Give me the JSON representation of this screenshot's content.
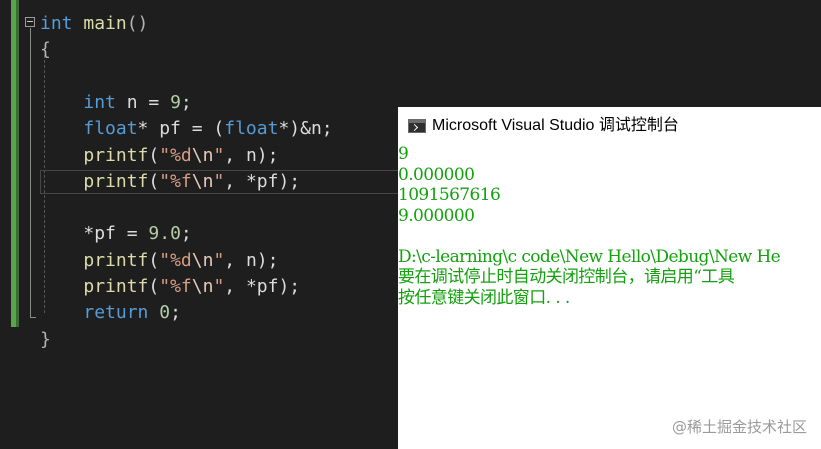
{
  "editor": {
    "lines": [
      {
        "tokens": [
          {
            "t": "int",
            "c": "kw"
          },
          {
            "t": " ",
            "c": "id"
          },
          {
            "t": "main",
            "c": "fn"
          },
          {
            "t": "()",
            "c": "punc"
          }
        ]
      },
      {
        "tokens": [
          {
            "t": "{",
            "c": "punc"
          }
        ]
      },
      {
        "tokens": []
      },
      {
        "tokens": [
          {
            "t": "    ",
            "c": "id"
          },
          {
            "t": "int",
            "c": "kw"
          },
          {
            "t": " n = ",
            "c": "id"
          },
          {
            "t": "9",
            "c": "num"
          },
          {
            "t": ";",
            "c": "id"
          }
        ]
      },
      {
        "tokens": [
          {
            "t": "    ",
            "c": "id"
          },
          {
            "t": "float",
            "c": "kw"
          },
          {
            "t": "* pf = (",
            "c": "id"
          },
          {
            "t": "float",
            "c": "kw"
          },
          {
            "t": "*)&n;",
            "c": "id"
          }
        ]
      },
      {
        "tokens": [
          {
            "t": "    ",
            "c": "id"
          },
          {
            "t": "printf",
            "c": "fn"
          },
          {
            "t": "(",
            "c": "id"
          },
          {
            "t": "\"%d",
            "c": "str"
          },
          {
            "t": "\\n",
            "c": "esc"
          },
          {
            "t": "\"",
            "c": "str"
          },
          {
            "t": ", n);",
            "c": "id"
          }
        ]
      },
      {
        "tokens": [
          {
            "t": "    ",
            "c": "id"
          },
          {
            "t": "printf",
            "c": "fn"
          },
          {
            "t": "(",
            "c": "id"
          },
          {
            "t": "\"%f",
            "c": "str"
          },
          {
            "t": "\\n",
            "c": "esc"
          },
          {
            "t": "\"",
            "c": "str"
          },
          {
            "t": ", *pf);",
            "c": "id"
          }
        ]
      },
      {
        "tokens": []
      },
      {
        "tokens": [
          {
            "t": "    ",
            "c": "id"
          },
          {
            "t": "*pf = ",
            "c": "id"
          },
          {
            "t": "9.0",
            "c": "num"
          },
          {
            "t": ";",
            "c": "id"
          }
        ]
      },
      {
        "tokens": [
          {
            "t": "    ",
            "c": "id"
          },
          {
            "t": "printf",
            "c": "fn"
          },
          {
            "t": "(",
            "c": "id"
          },
          {
            "t": "\"%d",
            "c": "str"
          },
          {
            "t": "\\n",
            "c": "esc"
          },
          {
            "t": "\"",
            "c": "str"
          },
          {
            "t": ", n);",
            "c": "id"
          }
        ]
      },
      {
        "tokens": [
          {
            "t": "    ",
            "c": "id"
          },
          {
            "t": "printf",
            "c": "fn"
          },
          {
            "t": "(",
            "c": "id"
          },
          {
            "t": "\"%f",
            "c": "str"
          },
          {
            "t": "\\n",
            "c": "esc"
          },
          {
            "t": "\"",
            "c": "str"
          },
          {
            "t": ", *pf);",
            "c": "id"
          }
        ]
      },
      {
        "tokens": [
          {
            "t": "    ",
            "c": "id"
          },
          {
            "t": "return",
            "c": "kw"
          },
          {
            "t": " ",
            "c": "id"
          },
          {
            "t": "0",
            "c": "num"
          },
          {
            "t": ";",
            "c": "id"
          }
        ]
      },
      {
        "tokens": [
          {
            "t": "}",
            "c": "punc"
          }
        ]
      }
    ]
  },
  "console": {
    "title": "Microsoft Visual Studio 调试控制台",
    "output_lines": [
      "9",
      "0.000000",
      "1091567616",
      "9.000000",
      "",
      "D:\\c-learning\\c code\\New Hello\\Debug\\New He",
      "要在调试停止时自动关闭控制台，请启用“工具",
      "按任意键关闭此窗口. . ."
    ]
  },
  "watermark": "@稀土掘金技术社区"
}
